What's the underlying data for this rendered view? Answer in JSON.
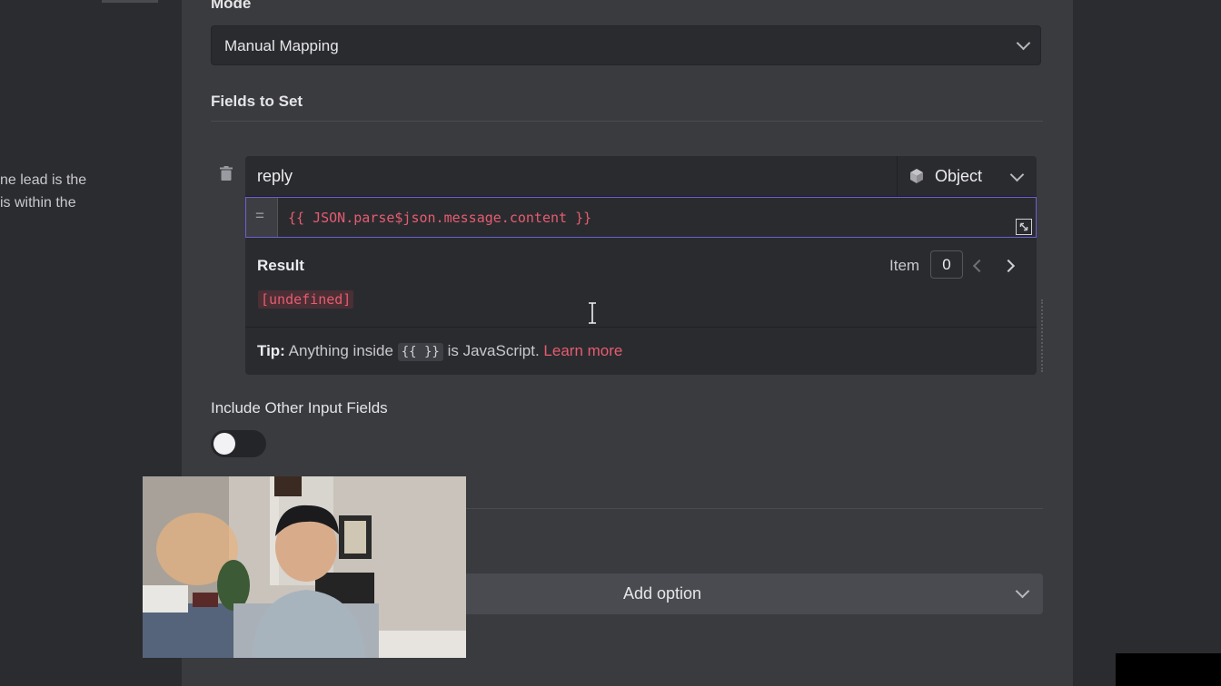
{
  "left_panel": {
    "text_line1": "ne lead is the",
    "text_line2": "is within the"
  },
  "mode": {
    "label": "Mode",
    "selected": "Manual Mapping"
  },
  "fields_to_set": {
    "title": "Fields to Set",
    "field": {
      "name": "reply",
      "type": "Object",
      "type_icon": "cube-icon",
      "expression": "{{ JSON.parse$json.message.content }}",
      "expression_prefix": "="
    },
    "result": {
      "label": "Result",
      "item_label": "Item",
      "item_index": "0",
      "value": "[undefined]"
    },
    "tip": {
      "prefix": "Tip:",
      "text_before": "Anything inside",
      "code": "{{ }}",
      "text_after": "is JavaScript.",
      "link": "Learn more"
    }
  },
  "include_other": {
    "label": "Include Other Input Fields",
    "enabled": false
  },
  "options": {
    "add_option_label": "Add option"
  },
  "colors": {
    "accent_expression": "#e65c70",
    "focus_border": "#6b5fd6",
    "panel_bg": "#3a3b3f"
  }
}
